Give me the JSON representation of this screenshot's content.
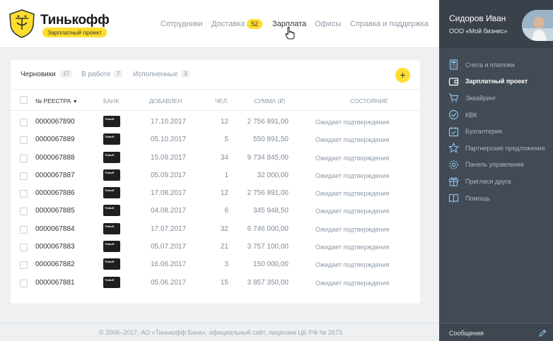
{
  "brand": {
    "name": "Тинькофф",
    "badge": "Зарплатный проект",
    "accent": "#ffdd2d"
  },
  "nav": {
    "items": [
      {
        "label": "Сотрудники"
      },
      {
        "label": "Доставка",
        "badge": "52"
      },
      {
        "label": "Зарплата"
      },
      {
        "label": "Офисы"
      },
      {
        "label": "Справка и поддержка"
      }
    ]
  },
  "user": {
    "name": "Сидоров Иван",
    "company": "ООО «Мой бизнес»"
  },
  "sidebar": {
    "items": [
      {
        "label": "Счета и платежи",
        "icon": "calculator-icon"
      },
      {
        "label": "Зарплатный проект",
        "icon": "wallet-icon",
        "active": true
      },
      {
        "label": "Эквайринг",
        "icon": "cart-icon"
      },
      {
        "label": "КВК",
        "icon": "check-badge-icon"
      },
      {
        "label": "Бухгалтерия",
        "icon": "calendar-check-icon"
      },
      {
        "label": "Партнерские предложения",
        "icon": "star-icon"
      },
      {
        "label": "Панель управления",
        "icon": "gear-icon"
      },
      {
        "label": "Пригласи друга",
        "icon": "gift-icon"
      },
      {
        "label": "Помощь",
        "icon": "book-icon"
      }
    ],
    "messages_label": "Сообщения"
  },
  "tabs": [
    {
      "label": "Черновики",
      "count": "17"
    },
    {
      "label": "В работе",
      "count": "7"
    },
    {
      "label": "Исполненные",
      "count": "3"
    }
  ],
  "add_button": "+",
  "table": {
    "headers": {
      "registry": "№ РЕЕСТРА",
      "bank": "БАНК",
      "added": "ДОБАВЛЕН",
      "people": "ЧЕЛ.",
      "sum": "СУММА (₽)",
      "status": "СОСТОЯНИЕ"
    },
    "bank_card_text": "Tinkoff",
    "rows": [
      {
        "number": "0000067890",
        "date": "17.10.2017",
        "people": "12",
        "sum": "2 756 891,00",
        "status": "Ожидает подтверждения"
      },
      {
        "number": "0000067889",
        "date": "05.10.2017",
        "people": "5",
        "sum": "550 891,50",
        "status": "Ожидает подтверждения"
      },
      {
        "number": "0000067888",
        "date": "15.09.2017",
        "people": "34",
        "sum": "9 734 845,00",
        "status": "Ожидает подтверждения"
      },
      {
        "number": "0000067887",
        "date": "05.09.2017",
        "people": "1",
        "sum": "32 000,00",
        "status": "Ожидает подтверждения"
      },
      {
        "number": "0000067886",
        "date": "17.08.2017",
        "people": "12",
        "sum": "2 756 891,00",
        "status": "Ожидает подтверждения"
      },
      {
        "number": "0000067885",
        "date": "04.08.2017",
        "people": "6",
        "sum": "345 948,50",
        "status": "Ожидает подтверждения"
      },
      {
        "number": "0000067884",
        "date": "17.07.2017",
        "people": "32",
        "sum": "6 746 000,00",
        "status": "Ожидает подтверждения"
      },
      {
        "number": "0000067883",
        "date": "05.07.2017",
        "people": "21",
        "sum": "3 757 100,00",
        "status": "Ожидает подтверждения"
      },
      {
        "number": "0000067882",
        "date": "16.06.2017",
        "people": "3",
        "sum": "150 000,00",
        "status": "Ожидает подтверждения"
      },
      {
        "number": "0000067881",
        "date": "05.06.2017",
        "people": "15",
        "sum": "3 857 350,00",
        "status": "Ожидает подтверждения"
      }
    ]
  },
  "footer": {
    "text": "© 2006–2017, АО «Тинькофф Банк», официальный сайт, лицензия ЦБ РФ № 2673"
  }
}
